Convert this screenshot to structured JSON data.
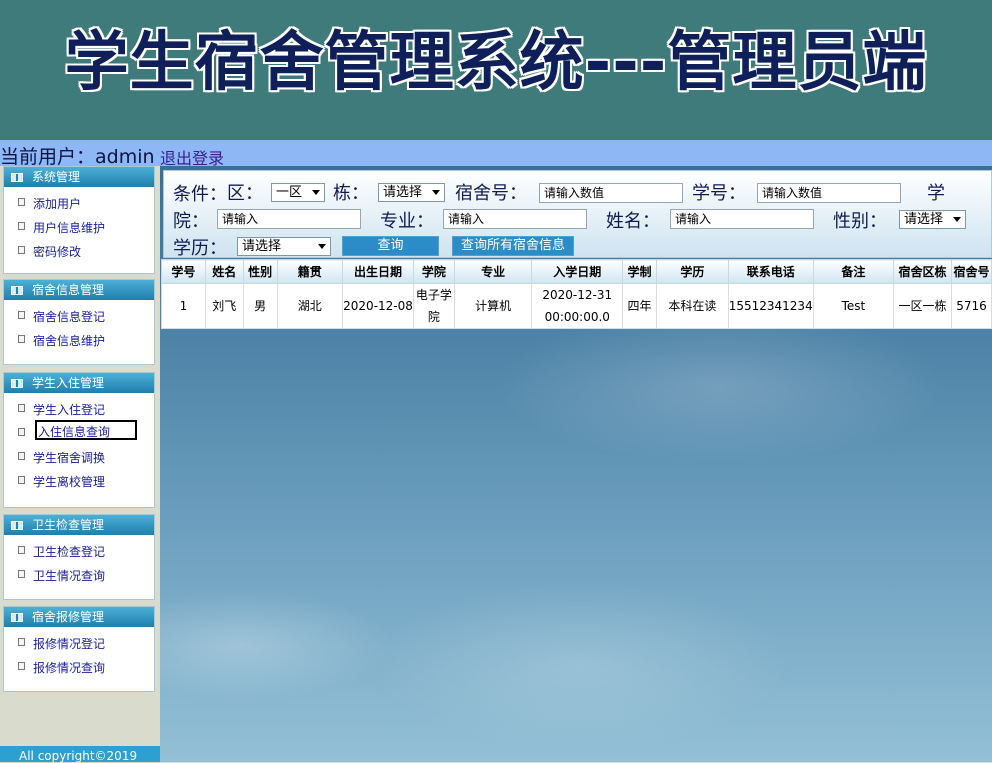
{
  "app": {
    "title": "学生宿舍管理系统---管理员端"
  },
  "userbar": {
    "current_user": "当前用户：admin",
    "logout": "退出登录"
  },
  "sidebar": {
    "groups": [
      {
        "title": "系统管理",
        "items": [
          "添加用户",
          "用户信息维护",
          "密码修改"
        ]
      },
      {
        "title": "宿舍信息管理",
        "items": [
          "宿舍信息登记",
          "宿舍信息维护"
        ]
      },
      {
        "title": "学生入住管理",
        "items": [
          "学生入住登记",
          "入住信息查询",
          "学生宿舍调换",
          "学生离校管理"
        ]
      },
      {
        "title": "卫生检查管理",
        "items": [
          "卫生检查登记",
          "卫生情况查询"
        ]
      },
      {
        "title": "宿舍报修管理",
        "items": [
          "报修情况登记",
          "报修情况查询"
        ]
      }
    ]
  },
  "footer": {
    "copyright": "All copyright©2019"
  },
  "filters": {
    "condition_label": "条件：",
    "area_label": "区：",
    "area_value": "一区",
    "building_label": "栋：",
    "building_value": "请选择",
    "room_label": "宿舍号：",
    "room_placeholder": "请输入数值",
    "student_id_label": "学号：",
    "student_id_placeholder": "请输入数值",
    "college_label_1": "学",
    "college_label_2": "院：",
    "college_placeholder": "请输入",
    "major_label": "专业：",
    "major_placeholder": "请输入",
    "name_label": "姓名：",
    "name_placeholder": "请输入",
    "gender_label": "性别：",
    "gender_value": "请选择",
    "education_label": "学历：",
    "education_value": "请选择",
    "query_button": "查询",
    "query_all_button": "查询所有宿舍信息"
  },
  "table": {
    "headers": [
      "学号",
      "姓名",
      "性别",
      "籍贯",
      "出生日期",
      "学院",
      "专业",
      "入学日期",
      "学制",
      "学历",
      "联系电话",
      "备注",
      "宿舍区栋",
      "宿舍号"
    ],
    "rows": [
      [
        "1",
        "刘飞",
        "男",
        "湖北",
        "2020-12-08",
        "电子学院",
        "计算机",
        "2020-12-31 00:00:00.0",
        "四年",
        "本科在读",
        "15512341234",
        "Test",
        "一区一栋",
        "5716"
      ]
    ]
  },
  "colors": {
    "header_bg": "#3f7b7b",
    "title_text": "#0f1f5a",
    "userbar_bg": "#8db8f5",
    "menu_head": "#1f7fad",
    "button_bg": "#2c8cc7"
  }
}
